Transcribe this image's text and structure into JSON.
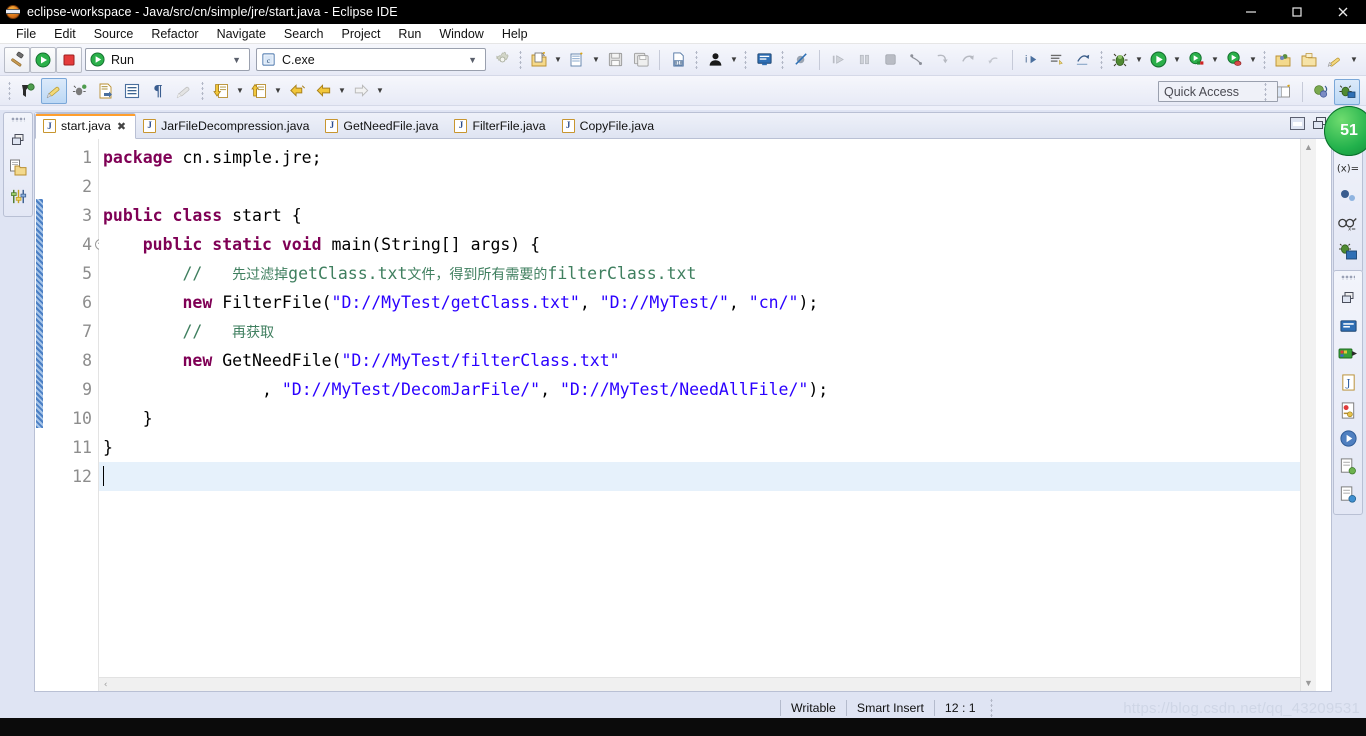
{
  "window": {
    "title": "eclipse-workspace - Java/src/cn/simple/jre/start.java - Eclipse IDE",
    "minimize_label": "—",
    "maximize_label": "❐",
    "close_label": "✕"
  },
  "menu": {
    "items": [
      "File",
      "Edit",
      "Source",
      "Refactor",
      "Navigate",
      "Search",
      "Project",
      "Run",
      "Window",
      "Help"
    ]
  },
  "toolbar": {
    "build_icon": "hammer-icon",
    "run_icon": "run-green-play-icon",
    "stop_icon": "stop-red-square-icon",
    "run_config_combo": {
      "value": "Run",
      "icon": "run-green-play-icon"
    },
    "launch_target_combo": {
      "value": "C.exe",
      "icon": "c-file-icon"
    },
    "settings_icon": "gear-icon",
    "group2": [
      "new-file-icon",
      "new-java-project-icon",
      "save-icon",
      "save-all-icon",
      "binary-file-icon",
      "person-icon",
      "console-view-icon",
      "skip-breakpoints-icon"
    ],
    "group3": [
      "step-over-icon",
      "pause-icon",
      "terminate-icon",
      "step-into-icon",
      "step-return-icon",
      "resume-icon"
    ],
    "group4": [
      "next-annotation-icon",
      "jump-icon",
      "build-all-icon",
      "debug-bug-icon",
      "run-icon",
      "run-last-tool-icon",
      "run-external-tool-icon",
      "open-type-icon",
      "open-task-icon",
      "search-pencil-icon"
    ],
    "quick_access": {
      "placeholder": "Quick Access",
      "value": "Quick Access"
    },
    "perspective_buttons": [
      "open-perspective-icon",
      "java-perspective-icon",
      "debug-perspective-icon"
    ],
    "badge": "51"
  },
  "toolbar2": {
    "icons": [
      "toggle-mark-occurrences-icon",
      "toggle-highlight-icon",
      "search-bug-icon",
      "open-declaration-icon",
      "outline-icon",
      "pilcrow-icon",
      "clear-marks-icon",
      "next-edit-icon",
      "prev-edit-icon",
      "back-icon",
      "forward-icon",
      "forward-history-icon"
    ]
  },
  "rails": {
    "left": [
      "restore-icon",
      "package-explorer-icon",
      "filters-icon"
    ],
    "right_top": [
      "restore-icon",
      "variables-icon",
      "breakpoints-icon",
      "expressions-icon",
      "debug-view-icon"
    ],
    "right_bottom": [
      "restore-icon",
      "console-icon",
      "servers-icon",
      "javadoc-icon",
      "declaration-icon",
      "progress-icon",
      "problems-icon",
      "search-result-icon"
    ]
  },
  "editor": {
    "tabs": [
      {
        "label": "start.java",
        "icon": "java-file-icon",
        "selected": true,
        "close": "✖"
      },
      {
        "label": "JarFileDecompression.java",
        "icon": "java-file-icon",
        "selected": false
      },
      {
        "label": "GetNeedFile.java",
        "icon": "java-file-icon",
        "selected": false
      },
      {
        "label": "FilterFile.java",
        "icon": "java-file-icon",
        "selected": false
      },
      {
        "label": "CopyFile.java",
        "icon": "java-file-icon",
        "selected": false
      }
    ],
    "stack_buttons": [
      "minimize-editor-icon",
      "maximize-editor-icon"
    ],
    "line_numbers": [
      "1",
      "2",
      "3",
      "4",
      "5",
      "6",
      "7",
      "8",
      "9",
      "10",
      "11",
      "12"
    ],
    "fold_marker_line": 4,
    "current_line": 12,
    "code_lines": [
      {
        "n": 1,
        "text": "package cn.simple.jre;"
      },
      {
        "n": 2,
        "text": ""
      },
      {
        "n": 3,
        "text": "public class start {"
      },
      {
        "n": 4,
        "text": "    public static void main(String[] args) {"
      },
      {
        "n": 5,
        "text": "        //   先过滤掉getClass.txt文件，得到所有需要的filterClass.txt"
      },
      {
        "n": 6,
        "text": "        new FilterFile(\"D://MyTest/getClass.txt\", \"D://MyTest/\", \"cn/\");"
      },
      {
        "n": 7,
        "text": "        //   再获取"
      },
      {
        "n": 8,
        "text": "        new GetNeedFile(\"D://MyTest/filterClass.txt\""
      },
      {
        "n": 9,
        "text": "                , \"D://MyTest/DecomJarFile/\", \"D://MyTest/NeedAllFile/\");"
      },
      {
        "n": 10,
        "text": "    }"
      },
      {
        "n": 11,
        "text": "}"
      },
      {
        "n": 12,
        "text": ""
      }
    ],
    "tokens": {
      "l1_kw": "package",
      "l1_rest": " cn.simple.jre;",
      "l3_kw1": "public class",
      "l3_rest": " start {",
      "l4_kw": "public static void",
      "l4_rest": " main(String[] args) {",
      "l5_slashes": "//",
      "l5_cjk_a": "先过滤掉",
      "l5_mono_a": "getClass.txt",
      "l5_cjk_b": "文件，得到所有需要的",
      "l5_mono_b": "filterClass.txt",
      "l6_kw": "new",
      "l6_call": " FilterFile(",
      "l6_s1": "\"D://MyTest/getClass.txt\"",
      "l6_c1": ", ",
      "l6_s2": "\"D://MyTest/\"",
      "l6_c2": ", ",
      "l6_s3": "\"cn/\"",
      "l6_end": ");",
      "l7_slashes": "//",
      "l7_cjk": "再获取",
      "l8_kw": "new",
      "l8_call": " GetNeedFile(",
      "l8_s1": "\"D://MyTest/filterClass.txt\"",
      "l9_c1": ", ",
      "l9_s1": "\"D://MyTest/DecomJarFile/\"",
      "l9_c2": ", ",
      "l9_s2": "\"D://MyTest/NeedAllFile/\"",
      "l9_end": ");",
      "l10": "    }",
      "l11": "}"
    },
    "scroll": {
      "up_arrow": "▲",
      "down_arrow": "▼",
      "left_arrow": "‹",
      "right_arrow": "›"
    }
  },
  "statusbar": {
    "writable": "Writable",
    "insert_mode": "Smart Insert",
    "position": "12 : 1",
    "watermark": "https://blog.csdn.net/qq_43209531"
  },
  "colors": {
    "keyword": "#7f0055",
    "string": "#2a00ff",
    "comment": "#3f7f5f",
    "tab_accent": "#ff9e2c",
    "selection": "#e6f1fb",
    "chrome": "#dfe4f3"
  }
}
